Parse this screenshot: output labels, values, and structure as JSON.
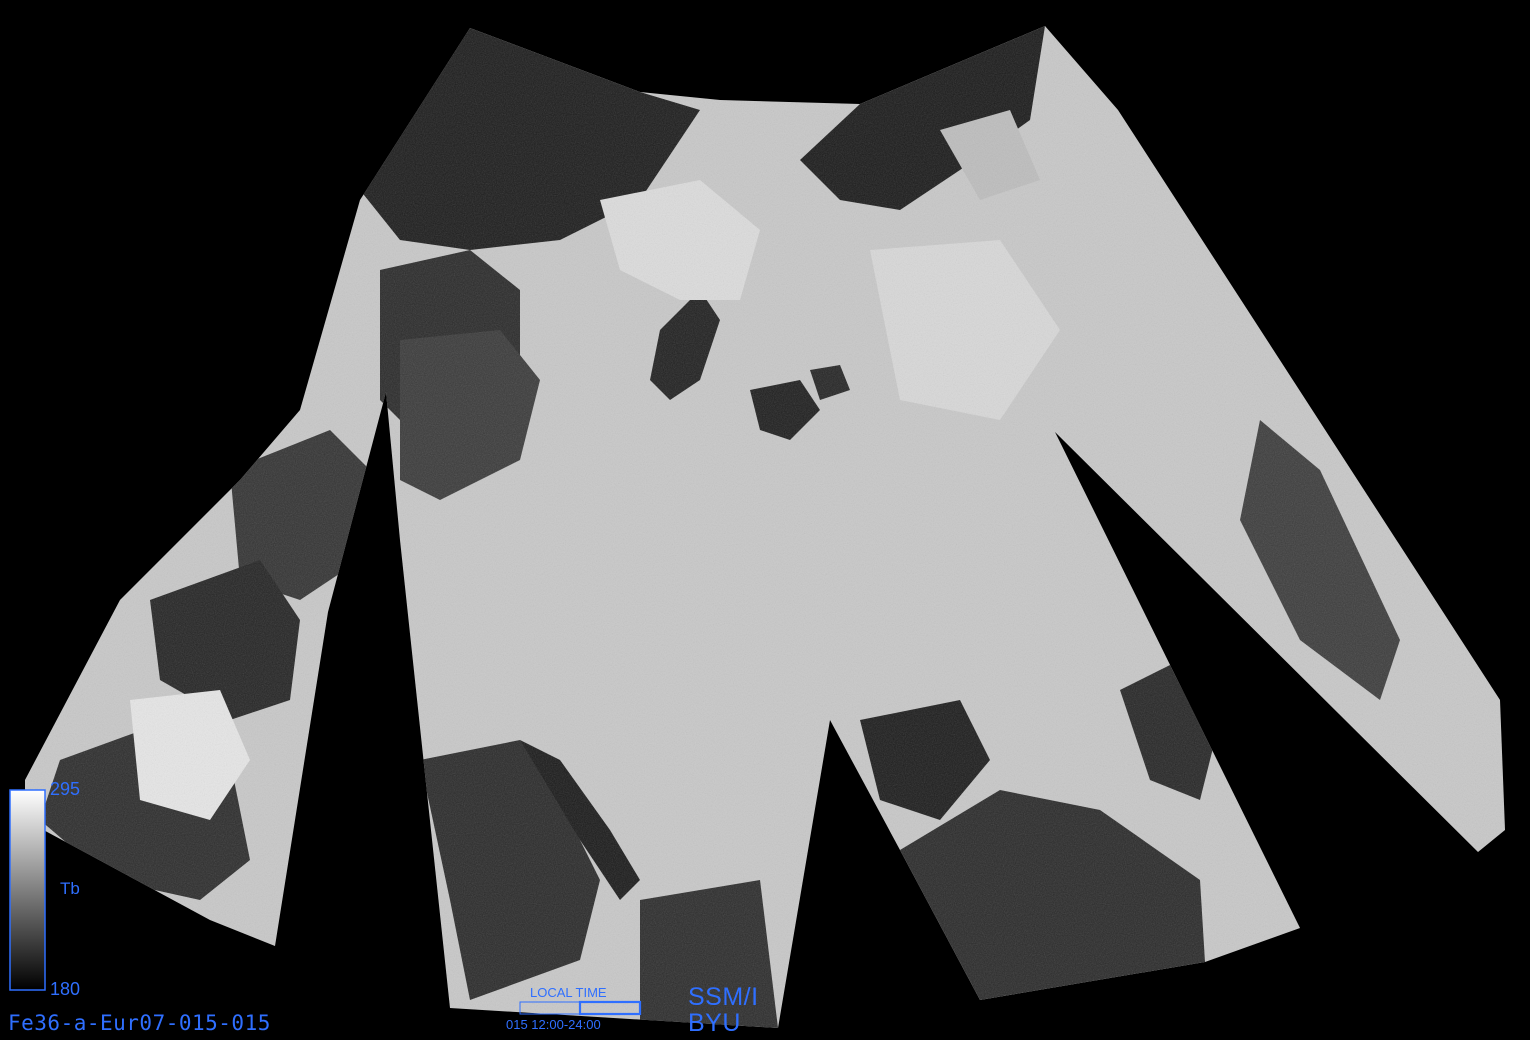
{
  "image_id": "Fe36-a-Eur07-015-015",
  "colorbar": {
    "max": "295",
    "min": "180",
    "variable": "Tb",
    "gradient_top": "#ffffff",
    "gradient_bottom": "#000000"
  },
  "local_time": {
    "title": "LOCAL TIME",
    "range": "015 12:00-24:00",
    "fill_start_fraction": 0.5,
    "fill_end_fraction": 1.0
  },
  "sensor": "SSM/I",
  "agency": "BYU",
  "colors": {
    "background": "#000000",
    "label_color": "#2f6fff",
    "land": "#d9d9d9",
    "ocean": "#2b2b2b"
  }
}
